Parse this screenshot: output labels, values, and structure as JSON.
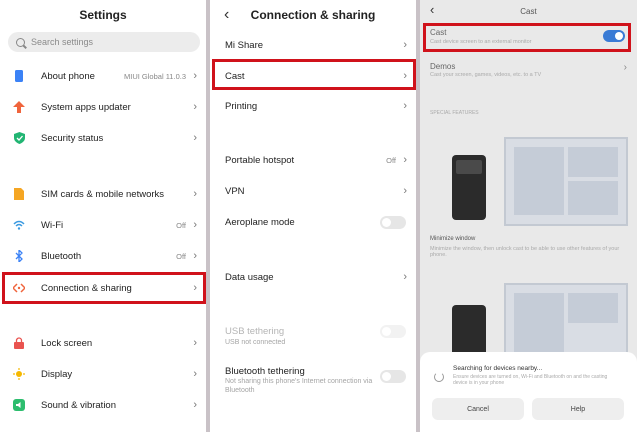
{
  "settings": {
    "title": "Settings",
    "search_placeholder": "Search settings",
    "items": [
      {
        "label": "About phone",
        "value": "MIUI Global 11.0.3",
        "color": "#3b82f6"
      },
      {
        "label": "System apps updater",
        "value": "",
        "color": "#f0643c"
      },
      {
        "label": "Security status",
        "value": "",
        "color": "#22b573"
      },
      {
        "label": "SIM cards & mobile networks",
        "value": "",
        "color": "#f5a623"
      },
      {
        "label": "Wi-Fi",
        "value": "Off",
        "color": "#3b9ae1"
      },
      {
        "label": "Bluetooth",
        "value": "Off",
        "color": "#3b82f6"
      },
      {
        "label": "Connection & sharing",
        "value": "",
        "color": "#f0643c"
      },
      {
        "label": "Lock screen",
        "value": "",
        "color": "#e9534f"
      },
      {
        "label": "Display",
        "value": "",
        "color": "#f5b800"
      },
      {
        "label": "Sound & vibration",
        "value": "",
        "color": "#2dbd6e"
      }
    ]
  },
  "connection": {
    "title": "Connection & sharing",
    "items": [
      {
        "label": "Mi Share"
      },
      {
        "label": "Cast"
      },
      {
        "label": "Printing"
      },
      {
        "label": "Portable hotspot",
        "value": "Off"
      },
      {
        "label": "VPN"
      },
      {
        "label": "Aeroplane mode"
      },
      {
        "label": "Data usage"
      },
      {
        "label": "USB tethering",
        "sub": "USB not connected"
      },
      {
        "label": "Bluetooth tethering",
        "sub": "Not sharing this phone's Internet connection via Bluetooth"
      }
    ]
  },
  "cast": {
    "title": "Cast",
    "cast_label": "Cast",
    "cast_sub": "Cast device screen to an external monitor",
    "demos_label": "Demos",
    "demos_sub": "Cast your screen, games, videos, etc. to a TV",
    "section": "SPECIAL FEATURES",
    "minimize_label": "Minimize window",
    "minimize_sub": "Minimize the window, then unlock cast to be able to use other features of your phone.",
    "sheet_title": "Searching for devices nearby...",
    "sheet_sub": "Ensure devices are turned on, Wi-Fi and Bluetooth on and the casting device is in your phone",
    "cancel": "Cancel",
    "help": "Help"
  },
  "accent": "#d0121b"
}
